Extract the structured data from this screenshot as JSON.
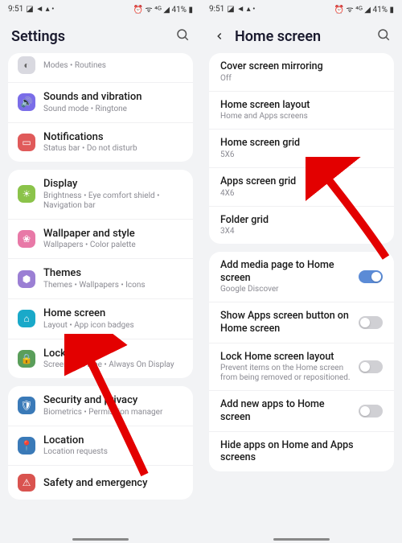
{
  "status": {
    "time": "9:51",
    "left_icons": "◪ ◄ ▴ •",
    "right_icons": "⏰ ᯤ ⁴ᴳ ◢ 41% ▮"
  },
  "left": {
    "title": "Settings",
    "groups": [
      {
        "items": [
          {
            "icon_bg": "#d9d9e0",
            "icon_glyph": "◐",
            "title": "",
            "sub": "Modes • Routines"
          },
          {
            "icon_bg": "#7a6de8",
            "icon_glyph": "🔊",
            "title": "Sounds and vibration",
            "sub": "Sound mode • Ringtone"
          },
          {
            "icon_bg": "#e05a5a",
            "icon_glyph": "▭",
            "title": "Notifications",
            "sub": "Status bar • Do not disturb"
          }
        ]
      },
      {
        "items": [
          {
            "icon_bg": "#8bc34a",
            "icon_glyph": "☀",
            "title": "Display",
            "sub": "Brightness • Eye comfort shield • Navigation bar"
          },
          {
            "icon_bg": "#e879a7",
            "icon_glyph": "❀",
            "title": "Wallpaper and style",
            "sub": "Wallpapers • Color palette"
          },
          {
            "icon_bg": "#9b7fd4",
            "icon_glyph": "⬢",
            "title": "Themes",
            "sub": "Themes • Wallpapers • Icons"
          },
          {
            "icon_bg": "#1aa9c9",
            "icon_glyph": "⌂",
            "title": "Home screen",
            "sub": "Layout • App icon badges"
          },
          {
            "icon_bg": "#5a9e5a",
            "icon_glyph": "🔒",
            "title": "Lock screen",
            "sub": "Screen lock type • Always On Display"
          }
        ]
      },
      {
        "items": [
          {
            "icon_bg": "#3a7ab8",
            "icon_glyph": "🛡",
            "title": "Security and privacy",
            "sub": "Biometrics • Permission manager"
          },
          {
            "icon_bg": "#3a7ab8",
            "icon_glyph": "📍",
            "title": "Location",
            "sub": "Location requests"
          },
          {
            "icon_bg": "#d9534f",
            "icon_glyph": "⚠",
            "title": "Safety and emergency",
            "sub": ""
          }
        ]
      }
    ]
  },
  "right": {
    "title": "Home screen",
    "group1": [
      {
        "title": "Cover screen mirroring",
        "sub": "Off",
        "accent": false
      },
      {
        "title": "Home screen layout",
        "sub": "Home and Apps screens",
        "accent": true
      },
      {
        "title": "Home screen grid",
        "sub": "5X6",
        "accent": false
      },
      {
        "title": "Apps screen grid",
        "sub": "4X6",
        "accent": false
      },
      {
        "title": "Folder grid",
        "sub": "3X4",
        "accent": false
      }
    ],
    "group2": [
      {
        "title": "Add media page to Home screen",
        "sub": "Google Discover",
        "toggle": true,
        "on": true
      },
      {
        "title": "Show Apps screen button on Home screen",
        "sub": "",
        "toggle": true,
        "on": false
      },
      {
        "title": "Lock Home screen layout",
        "sub": "Prevent items on the Home screen from being removed or repositioned.",
        "toggle": true,
        "on": false
      },
      {
        "title": "Add new apps to Home screen",
        "sub": "",
        "toggle": true,
        "on": false
      },
      {
        "title": "Hide apps on Home and Apps screens",
        "sub": "",
        "toggle": false
      }
    ]
  }
}
